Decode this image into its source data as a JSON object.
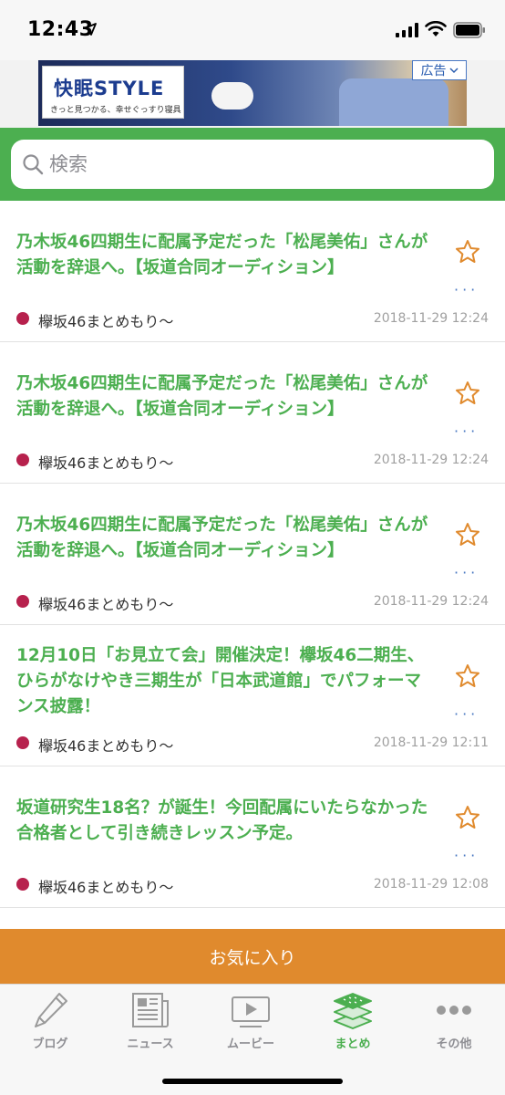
{
  "status_bar": {
    "time": "12:43"
  },
  "ad": {
    "logo_text": "快眠STYLE",
    "tagline": "きっと見つかる、幸せぐっすり寝具",
    "badge_label": "広告"
  },
  "search": {
    "placeholder": "検索"
  },
  "articles": [
    {
      "title": "乃木坂46四期生に配属予定だった「松尾美佑」さんが活動を辞退へ。【坂道合同オーディション】",
      "source": "欅坂46まとめもり〜",
      "date": "2018-11-29 12:24"
    },
    {
      "title": "乃木坂46四期生に配属予定だった「松尾美佑」さんが活動を辞退へ。【坂道合同オーディション】",
      "source": "欅坂46まとめもり〜",
      "date": "2018-11-29 12:24"
    },
    {
      "title": "乃木坂46四期生に配属予定だった「松尾美佑」さんが活動を辞退へ。【坂道合同オーディション】",
      "source": "欅坂46まとめもり〜",
      "date": "2018-11-29 12:24"
    },
    {
      "title": "12月10日「お見立て会」開催決定！欅坂46二期生、ひらがなけやき三期生が「日本武道館」でパフォーマンス披露！",
      "source": "欅坂46まとめもり〜",
      "date": "2018-11-29 12:11"
    },
    {
      "title": "坂道研究生18名？が誕生！今回配属にいたらなかった合格者として引き続きレッスン予定。",
      "source": "欅坂46まとめもり〜",
      "date": "2018-11-29 12:08"
    }
  ],
  "favorites_button": "お気に入り",
  "tabs": [
    {
      "label": "ブログ",
      "icon": "pen-icon"
    },
    {
      "label": "ニュース",
      "icon": "newspaper-icon"
    },
    {
      "label": "ムービー",
      "icon": "play-icon"
    },
    {
      "label": "まとめ",
      "icon": "layers-icon",
      "active": true
    },
    {
      "label": "その他",
      "icon": "more-icon"
    }
  ],
  "colors": {
    "accent_green": "#4caf50",
    "favorites_orange": "#e08a2d",
    "source_dot": "#b7214d",
    "star": "#e08a2d"
  }
}
